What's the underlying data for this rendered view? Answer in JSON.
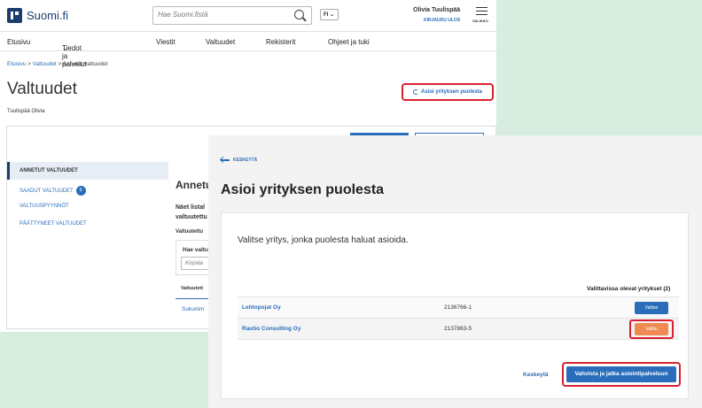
{
  "header": {
    "logo_text": "Suomi.fi",
    "search_placeholder": "Hae Suomi.fistä",
    "language": "FI",
    "user_name": "Olivia Tuulispää",
    "logout_label": "KIRJAUDU ULOS",
    "menu_label": "VALIKKO"
  },
  "nav": [
    "Etusivu",
    "Tiedot ja palvelut",
    "Viestit",
    "Valtuudet",
    "Rekisterit",
    "Ohjeet ja tuki"
  ],
  "breadcrumb": {
    "home": "Etusivu",
    "sep": ">",
    "mid": "Valtuudet",
    "current": "Annetut valtuudet"
  },
  "page": {
    "title": "Valtuudet",
    "act_button": "Asioi yrityksen puolesta",
    "person": "Tuulispää Olivia"
  },
  "sidebar": {
    "items": [
      {
        "label": "ANNETUT VALTUUDET"
      },
      {
        "label": "SAADUT VALTUUDET",
        "badge": "6"
      },
      {
        "label": "VALTUUSPYYNNÖT"
      },
      {
        "label": "PÄÄTTYNEET VALTUUDET"
      }
    ]
  },
  "main": {
    "heading": "Annetu",
    "para_line1": "Näet listal",
    "para_line2": "valtuutettu",
    "subhead": "Valtuutettu",
    "filter_label": "Hae valtu",
    "filter_placeholder": "Kirjoita",
    "col_header": "Valtuutett",
    "row_link": "Sukunim"
  },
  "modal": {
    "cancel_top": "KESKEYTÄ",
    "title": "Asioi yrityksen puolesta",
    "lead": "Valitse yritys, jonka puolesta haluat asioida.",
    "table_heading": "Valittavissa olevat yritykset (2)",
    "companies": [
      {
        "name": "Lehtopojat Oy",
        "id": "2136766-1",
        "button": "Valitse"
      },
      {
        "name": "Rautio Consulting Oy",
        "id": "2137863-5",
        "button": "Valittu"
      }
    ],
    "cancel_bottom": "Keskeytä",
    "confirm": "Vahvista ja jatka asiointipalveluun"
  }
}
